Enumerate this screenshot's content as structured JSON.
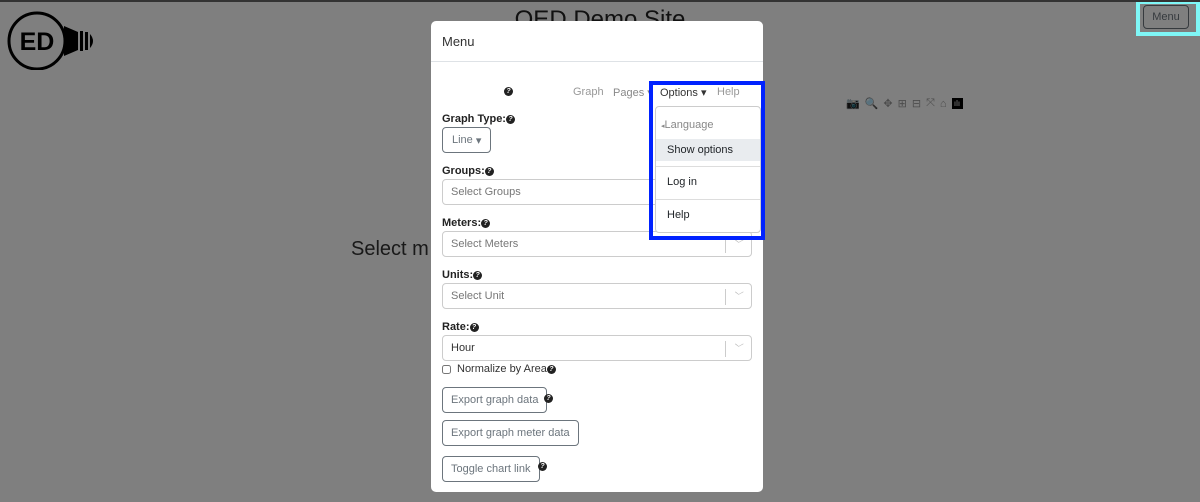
{
  "header": {
    "title": "OED Demo Site",
    "menu_button": "Menu",
    "logo_text": "ED"
  },
  "main": {
    "message": "Select m"
  },
  "toolbar": {
    "icons": [
      "camera-icon",
      "zoom-icon",
      "pan-icon",
      "zoom-in-icon",
      "zoom-out-icon",
      "autoscale-icon",
      "home-icon",
      "plotly-logo-icon"
    ]
  },
  "modal": {
    "title": "Menu",
    "nav": {
      "graph": "Graph",
      "pages": "Pages",
      "options": "Options",
      "help": "Help"
    },
    "options_menu": {
      "language": "Language",
      "show_options": "Show options",
      "log_in": "Log in",
      "help": "Help"
    },
    "graph_type": {
      "label": "Graph Type:",
      "value": "Line"
    },
    "groups": {
      "label": "Groups:",
      "placeholder": "Select Groups"
    },
    "meters": {
      "label": "Meters:",
      "placeholder": "Select Meters"
    },
    "units": {
      "label": "Units:",
      "placeholder": "Select Unit"
    },
    "rate": {
      "label": "Rate:",
      "value": "Hour"
    },
    "normalize": {
      "label": "Normalize by Area",
      "checked": false
    },
    "buttons": {
      "export_graph": "Export graph data",
      "export_meter": "Export graph meter data",
      "toggle_link": "Toggle chart link"
    }
  },
  "colors": {
    "highlight_blue": "#0022ff",
    "highlight_cyan": "#7ff7f7"
  }
}
